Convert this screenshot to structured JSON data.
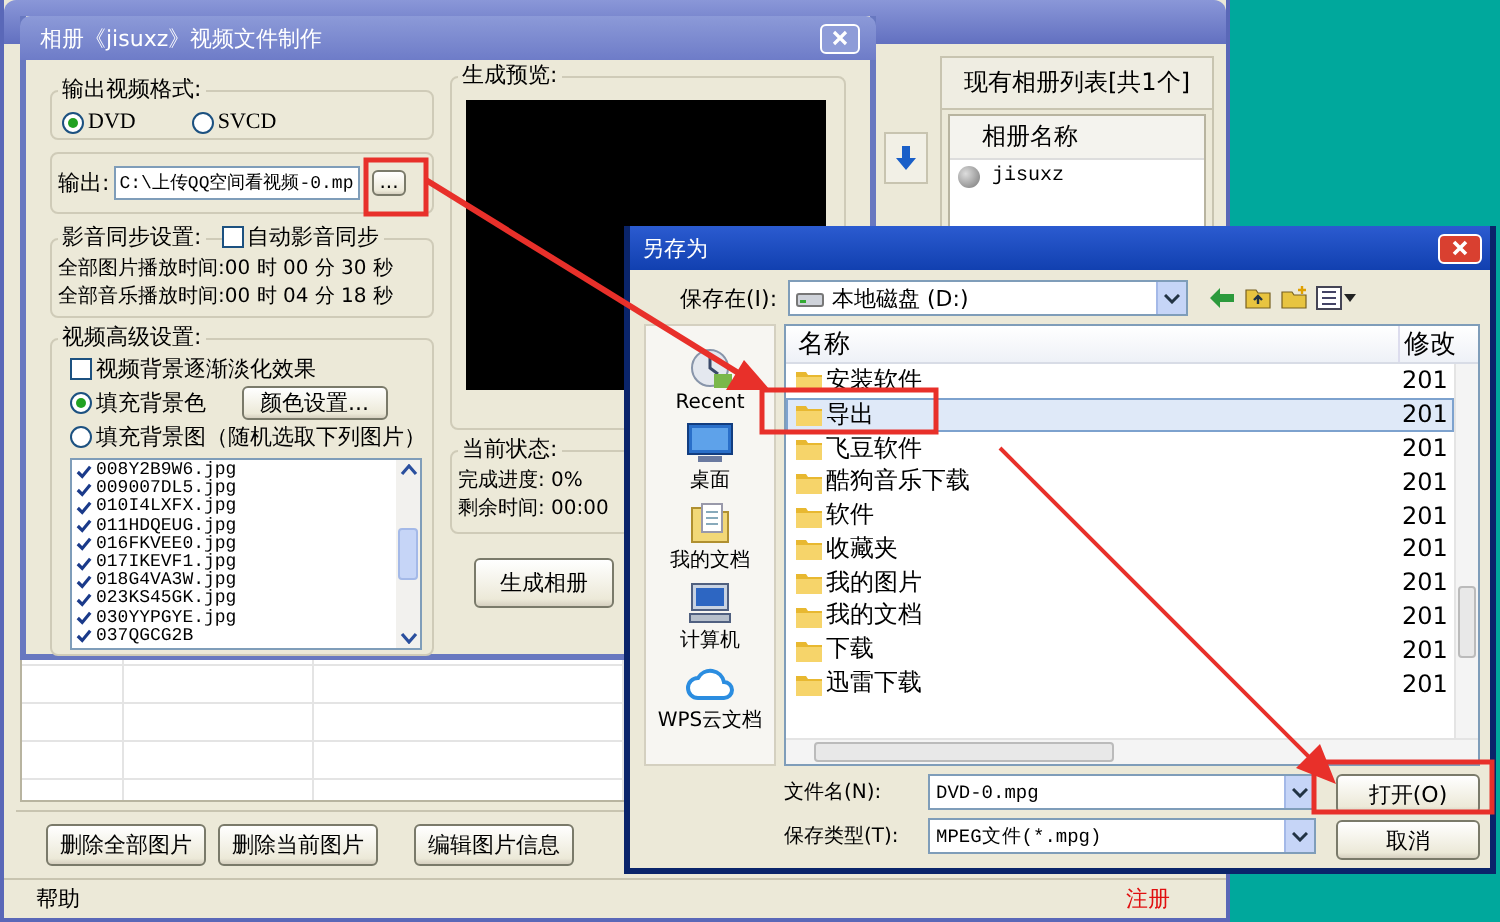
{
  "main_window": {
    "album_panel": {
      "title": "现有相册列表[共1个]",
      "column": "相册名称",
      "items": [
        {
          "name": "jisuxz",
          "selected": false
        }
      ]
    },
    "buttons": [
      "删除全部图片",
      "删除当前图片",
      "编辑图片信息"
    ],
    "status_bar": {
      "help": "帮助",
      "register": "注册"
    }
  },
  "video_dialog": {
    "title": "相册《jisuxz》视频文件制作",
    "format_group": {
      "label": "输出视频格式:",
      "options": [
        {
          "label": "DVD",
          "selected": true
        },
        {
          "label": "SVCD",
          "selected": false
        }
      ]
    },
    "output": {
      "label": "输出:",
      "value": "C:\\上传QQ空间看视频-0.mp",
      "browse_button": "..."
    },
    "sync_group": {
      "label": "影音同步设置:",
      "auto_sync": {
        "label": "自动影音同步",
        "checked": false
      },
      "lines": [
        "全部图片播放时间:00 时 00 分 30 秒",
        "全部音乐播放时间:00 时 04 分 18 秒"
      ]
    },
    "advanced_group": {
      "label": "视频高级设置:",
      "fade": {
        "label": "视频背景逐渐淡化效果",
        "checked": false
      },
      "fill_options": [
        {
          "label": "填充背景色",
          "selected": true
        },
        {
          "label": "填充背景图（随机选取下列图片）",
          "selected": false
        }
      ],
      "color_button": "颜色设置...",
      "images": [
        {
          "name": "008Y2B9W6.jpg",
          "checked": true
        },
        {
          "name": "009007DL5.jpg",
          "checked": true
        },
        {
          "name": "010I4LXFX.jpg",
          "checked": true
        },
        {
          "name": "011HDQEUG.jpg",
          "checked": true
        },
        {
          "name": "016FKVEE0.jpg",
          "checked": true
        },
        {
          "name": "017IKEVF1.jpg",
          "checked": true
        },
        {
          "name": "018G4VA3W.jpg",
          "checked": true
        },
        {
          "name": "023KS45GK.jpg",
          "checked": true
        },
        {
          "name": "030YYPGYE.jpg",
          "checked": true
        },
        {
          "name": "037QGCG2B",
          "checked": true
        }
      ]
    },
    "preview_group": {
      "label": "生成预览:"
    },
    "status_group": {
      "label": "当前状态:",
      "progress": "完成进度: 0%",
      "remaining": "剩余时间: 00:00"
    },
    "generate_button": "生成相册"
  },
  "save_dialog": {
    "title": "另存为",
    "save_in_label": "保存在(I):",
    "location": "本地磁盘 (D:)",
    "places": [
      {
        "label": "Recent",
        "kind": "recent"
      },
      {
        "label": "桌面",
        "kind": "desktop"
      },
      {
        "label": "我的文档",
        "kind": "documents"
      },
      {
        "label": "计算机",
        "kind": "computer"
      },
      {
        "label": "WPS云文档",
        "kind": "cloud"
      }
    ],
    "columns": [
      "名称",
      "修改"
    ],
    "files": [
      {
        "name": "安装软件",
        "modified": "201",
        "selected": false
      },
      {
        "name": "导出",
        "modified": "201",
        "selected": true
      },
      {
        "name": "飞豆软件",
        "modified": "201",
        "selected": false
      },
      {
        "name": "酷狗音乐下载",
        "modified": "201",
        "selected": false
      },
      {
        "name": "软件",
        "modified": "201",
        "selected": false
      },
      {
        "name": "收藏夹",
        "modified": "201",
        "selected": false
      },
      {
        "name": "我的图片",
        "modified": "201",
        "selected": false
      },
      {
        "name": "我的文档",
        "modified": "201",
        "selected": false
      },
      {
        "name": "下载",
        "modified": "201",
        "selected": false
      },
      {
        "name": "迅雷下载",
        "modified": "201",
        "selected": false
      }
    ],
    "filename_label": "文件名(N):",
    "filename": "DVD-0.mpg",
    "type_label": "保存类型(T):",
    "type": "MPEG文件(*.mpg)",
    "buttons": [
      "打开(O)",
      "取消"
    ]
  }
}
